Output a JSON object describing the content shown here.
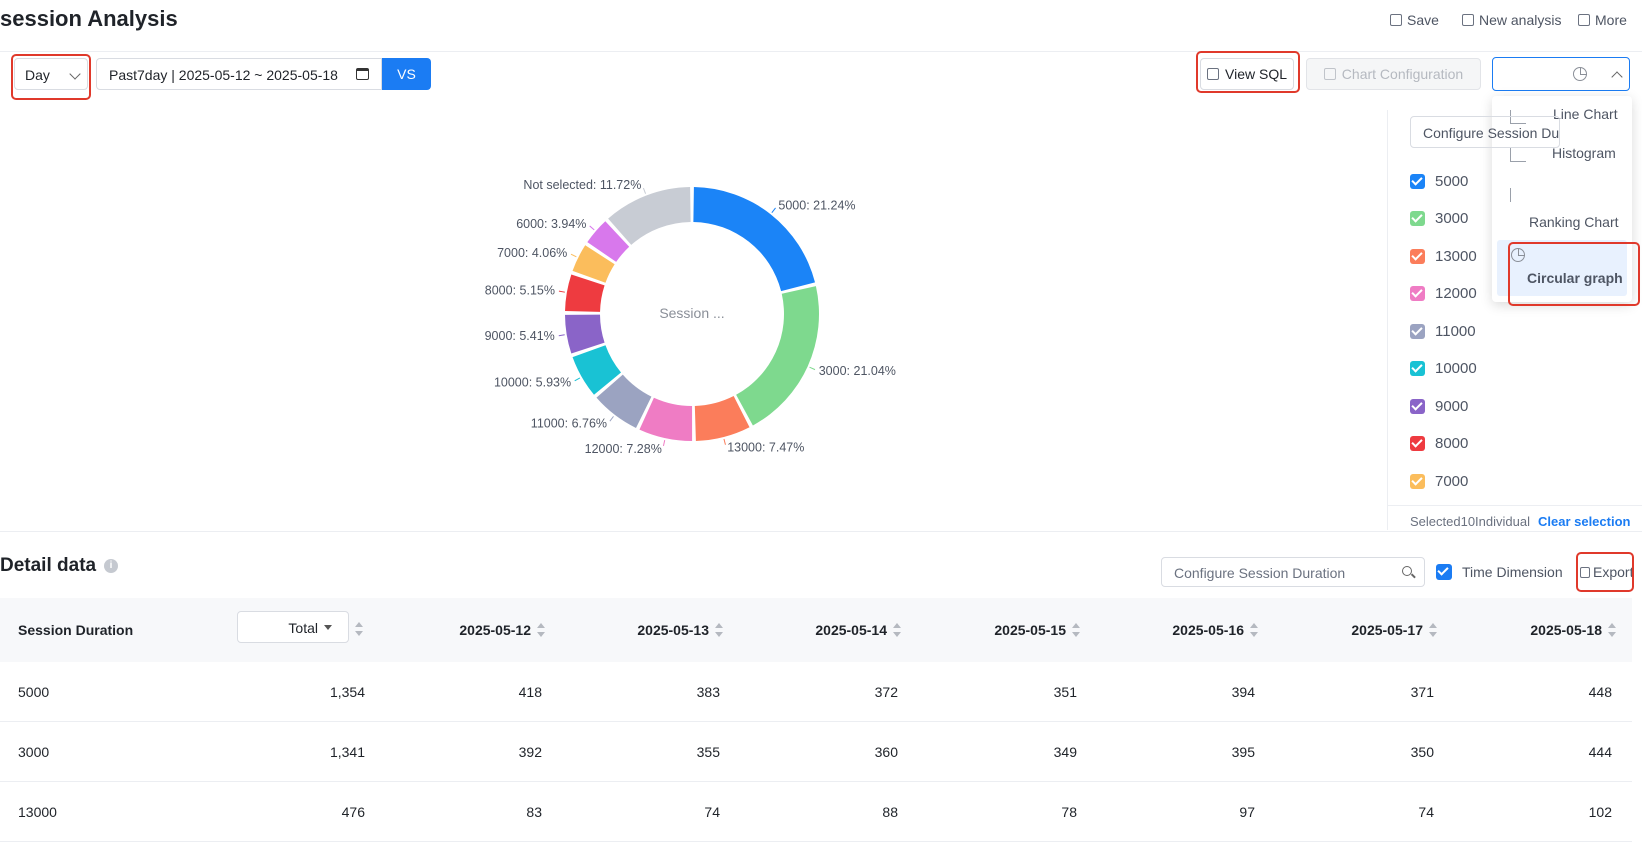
{
  "header": {
    "title": "session Analysis",
    "save": "Save",
    "new_analysis": "New analysis",
    "more": "More"
  },
  "toolbar": {
    "granularity": "Day",
    "date_range": "Past7day | 2025-05-12 ~ 2025-05-18",
    "vs": "VS",
    "view_sql": "View SQL",
    "chart_configuration": "Chart Configuration"
  },
  "chart_type_menu": {
    "items": [
      "Line Chart",
      "Histogram",
      "Ranking Chart",
      "Circular graph"
    ],
    "selected": "Circular graph"
  },
  "chart_data": {
    "type": "pie",
    "center_label": "Session ...",
    "slices": [
      {
        "label": "5000",
        "percent": 21.24,
        "text": "5000: 21.24%",
        "color": "#1b84f7"
      },
      {
        "label": "3000",
        "percent": 21.04,
        "text": "3000: 21.04%",
        "color": "#7ed98e"
      },
      {
        "label": "13000",
        "percent": 7.47,
        "text": "13000: 7.47%",
        "color": "#fb7d5b"
      },
      {
        "label": "12000",
        "percent": 7.28,
        "text": "12000: 7.28%",
        "color": "#ef7cc4"
      },
      {
        "label": "11000",
        "percent": 6.76,
        "text": "11000: 6.76%",
        "color": "#9ba3c1"
      },
      {
        "label": "10000",
        "percent": 5.93,
        "text": "10000: 5.93%",
        "color": "#19c2d4"
      },
      {
        "label": "9000",
        "percent": 5.41,
        "text": "9000: 5.41%",
        "color": "#8a64c8"
      },
      {
        "label": "8000",
        "percent": 5.15,
        "text": "8000: 5.15%",
        "color": "#ee3b40"
      },
      {
        "label": "7000",
        "percent": 4.06,
        "text": "7000: 4.06%",
        "color": "#fbbd5c"
      },
      {
        "label": "6000",
        "percent": 3.94,
        "text": "6000: 3.94%",
        "color": "#d878ec"
      },
      {
        "label": "Not selected",
        "percent": 11.72,
        "text": "Not selected: 11.72%",
        "color": "#c8ccd4"
      }
    ]
  },
  "legend": {
    "search_placeholder": "Configure Session Duration",
    "items": [
      {
        "label": "5000",
        "color": "#1b84f7"
      },
      {
        "label": "3000",
        "color": "#7ed98e"
      },
      {
        "label": "13000",
        "color": "#fb7d5b"
      },
      {
        "label": "12000",
        "color": "#ef7cc4"
      },
      {
        "label": "11000",
        "color": "#9ba3c1"
      },
      {
        "label": "10000",
        "color": "#19c2d4"
      },
      {
        "label": "9000",
        "color": "#8a64c8"
      },
      {
        "label": "8000",
        "color": "#ee3b40"
      },
      {
        "label": "7000",
        "color": "#fbbd5c"
      }
    ],
    "selected_text": "Selected10Individual",
    "clear": "Clear selection"
  },
  "detail": {
    "title": "Detail data",
    "search_placeholder": "Configure Session Duration",
    "time_dimension": "Time Dimension",
    "export": "Export",
    "columns": [
      "Session Duration",
      "Total",
      "2025-05-12",
      "2025-05-13",
      "2025-05-14",
      "2025-05-15",
      "2025-05-16",
      "2025-05-17",
      "2025-05-18"
    ],
    "rows": [
      [
        "5000",
        "1,354",
        "418",
        "383",
        "372",
        "351",
        "394",
        "371",
        "448"
      ],
      [
        "3000",
        "1,341",
        "392",
        "355",
        "360",
        "349",
        "395",
        "350",
        "444"
      ],
      [
        "13000",
        "476",
        "83",
        "74",
        "88",
        "78",
        "97",
        "74",
        "102"
      ]
    ]
  }
}
